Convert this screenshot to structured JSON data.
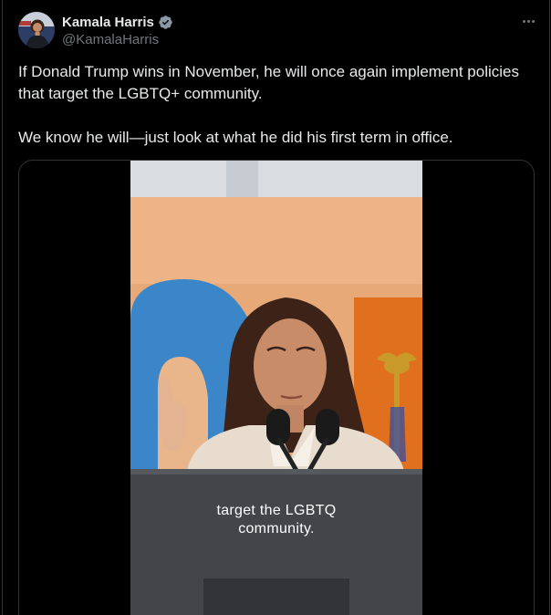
{
  "author": {
    "display_name": "Kamala Harris",
    "handle": "@KamalaHarris",
    "verified_icon": "verified-badge-icon",
    "verified_color": "#8b98a5"
  },
  "menu": {
    "more_icon": "more-horizontal-icon"
  },
  "tweet": {
    "paragraph_1": "If Donald Trump wins in November, he will once again implement policies that target the LGBTQ+ community.",
    "paragraph_2": "We know he will—just look at what he did his first term in office."
  },
  "video": {
    "caption_line_1": "target the LGBTQ",
    "caption_line_2": "community."
  },
  "colors": {
    "background": "#000000",
    "text_primary": "#e7e9ea",
    "text_secondary": "#71767b",
    "border": "#2f3336"
  }
}
